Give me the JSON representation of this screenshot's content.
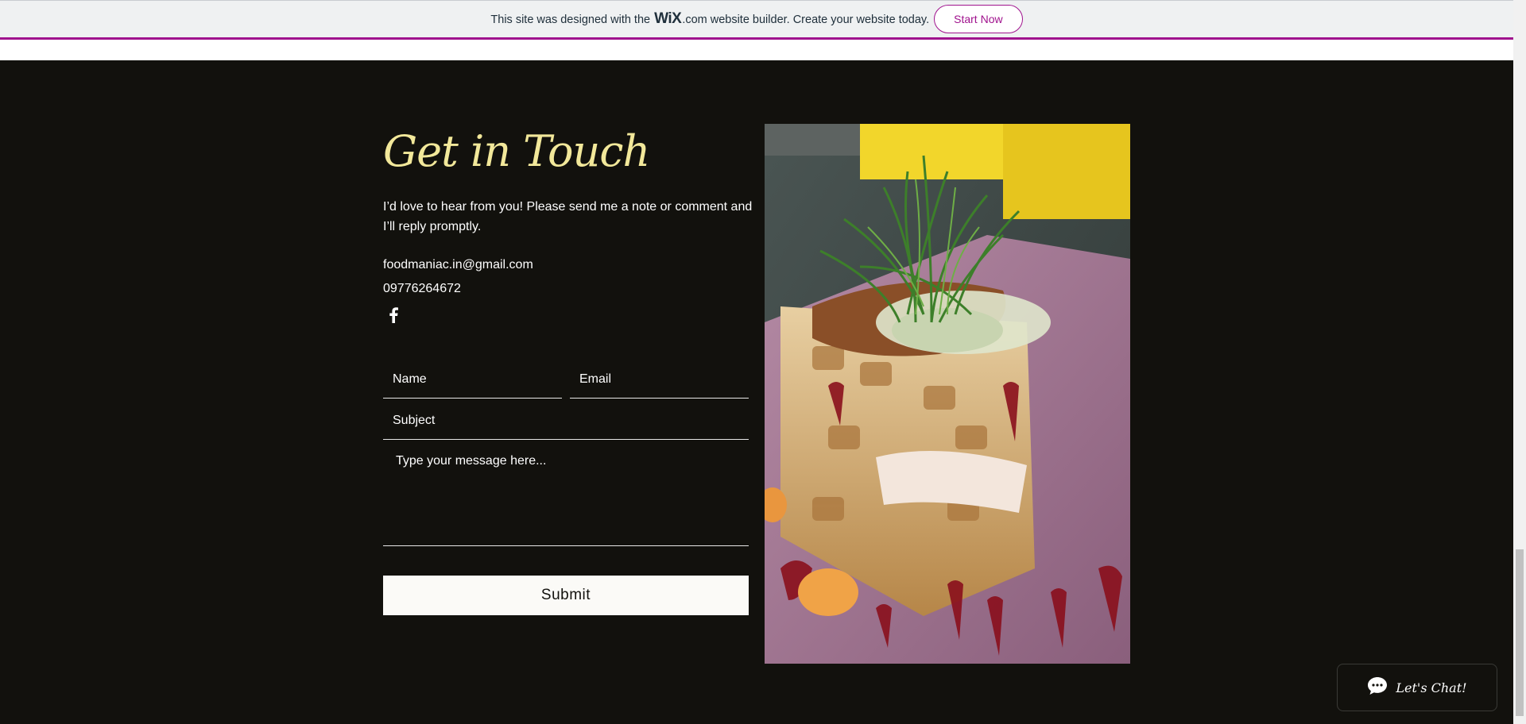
{
  "banner": {
    "text_before": "This site was designed with the",
    "logo": "WiX",
    "logo_suffix": ".com",
    "text_after": "website builder. Create your website today.",
    "cta_label": "Start Now",
    "accent": "#a0138e"
  },
  "contact": {
    "heading": "Get in Touch",
    "intro": "I’d love to hear from you! Please send me a note or comment and I’ll reply promptly.",
    "email": "foodmaniac.in@gmail.com",
    "phone": "09776264672",
    "social_icon": "facebook-icon",
    "heading_color": "#f2e89a",
    "background": "#12110d"
  },
  "form": {
    "name_placeholder": "Name",
    "email_placeholder": "Email",
    "subject_placeholder": "Subject",
    "message_placeholder": "Type your message here...",
    "submit_label": "Submit"
  },
  "chat": {
    "label": "Let's Chat!",
    "icon": "chat-bubble-icon"
  }
}
